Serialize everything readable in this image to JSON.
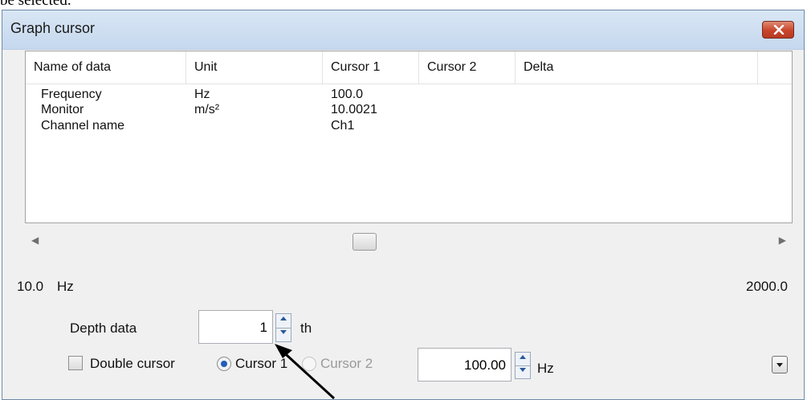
{
  "doc": {
    "partial_text": "be selected."
  },
  "window": {
    "title": "Graph cursor"
  },
  "table": {
    "columns": [
      "Name of data",
      "Unit",
      "Cursor 1",
      "Cursor 2",
      "Delta"
    ],
    "rows": [
      {
        "name": "Frequency",
        "unit": "Hz",
        "cursor1": "100.0",
        "cursor2": "",
        "delta": ""
      },
      {
        "name": "Monitor",
        "unit": "m/s²",
        "cursor1": "10.0021",
        "cursor2": "",
        "delta": ""
      },
      {
        "name": "Channel name",
        "unit": "",
        "cursor1": "Ch1",
        "cursor2": "",
        "delta": ""
      }
    ]
  },
  "range": {
    "min": "10.0",
    "unit": "Hz",
    "max": "2000.0"
  },
  "depth": {
    "label": "Depth data",
    "value": "1",
    "suffix": "th"
  },
  "cursor_options": {
    "double_cursor_label": "Double cursor",
    "double_cursor_checked": false,
    "cursor1_label": "Cursor 1",
    "cursor2_label": "Cursor 2",
    "selected": "Cursor 1",
    "position_value": "100.00",
    "position_unit": "Hz"
  },
  "colors": {
    "accent": "#1f5fb8",
    "title_bar": "#d2e1f1",
    "close_button": "#c8452a",
    "annotation_arrow": "#000000"
  }
}
